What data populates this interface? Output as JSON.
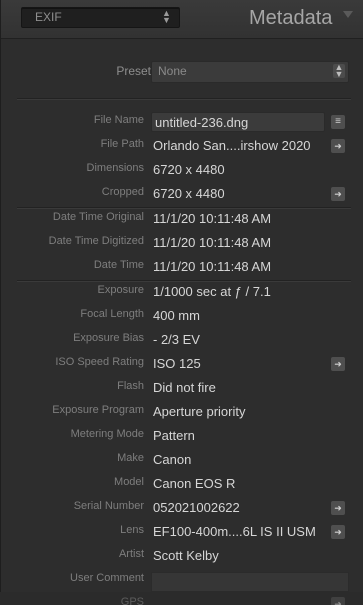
{
  "header": {
    "preset_select_label": "EXIF",
    "title": "Metadata"
  },
  "preset": {
    "label": "Preset",
    "value": "None"
  },
  "rows": [
    {
      "key": "File Name",
      "value": "untitled-236.dng",
      "button": "list"
    },
    {
      "key": "File Path",
      "value": "Orlando San....irshow 2020",
      "button": "arrow"
    },
    {
      "key": "Dimensions",
      "value": "6720 x 4480",
      "button": ""
    },
    {
      "key": "Cropped",
      "value": "6720 x 4480",
      "button": "arrow"
    },
    {
      "key": "Date Time Original",
      "value": "11/1/20 10:11:48 AM",
      "button": ""
    },
    {
      "key": "Date Time Digitized",
      "value": "11/1/20 10:11:48 AM",
      "button": ""
    },
    {
      "key": "Date Time",
      "value": "11/1/20 10:11:48 AM",
      "button": ""
    },
    {
      "key": "Exposure",
      "value": "1/1000 sec at ƒ / 7.1",
      "button": ""
    },
    {
      "key": "Focal Length",
      "value": "400 mm",
      "button": ""
    },
    {
      "key": "Exposure Bias",
      "value": "- 2/3 EV",
      "button": ""
    },
    {
      "key": "ISO Speed Rating",
      "value": "ISO 125",
      "button": "arrow"
    },
    {
      "key": "Flash",
      "value": "Did not fire",
      "button": ""
    },
    {
      "key": "Exposure Program",
      "value": "Aperture priority",
      "button": ""
    },
    {
      "key": "Metering Mode",
      "value": "Pattern",
      "button": ""
    },
    {
      "key": "Make",
      "value": "Canon",
      "button": ""
    },
    {
      "key": "Model",
      "value": "Canon EOS R",
      "button": ""
    },
    {
      "key": "Serial Number",
      "value": "052021002622",
      "button": "arrow"
    },
    {
      "key": "Lens",
      "value": "EF100-400m....6L IS II USM",
      "button": "arrow"
    },
    {
      "key": "Artist",
      "value": "Scott Kelby",
      "button": ""
    },
    {
      "key": "User Comment",
      "value": "",
      "button": ""
    },
    {
      "key": "GPS",
      "value": "",
      "button": "arrow"
    }
  ],
  "icons": {
    "list_glyph": "≡",
    "arrow_glyph": "➜",
    "updown_glyph": "⇕"
  }
}
